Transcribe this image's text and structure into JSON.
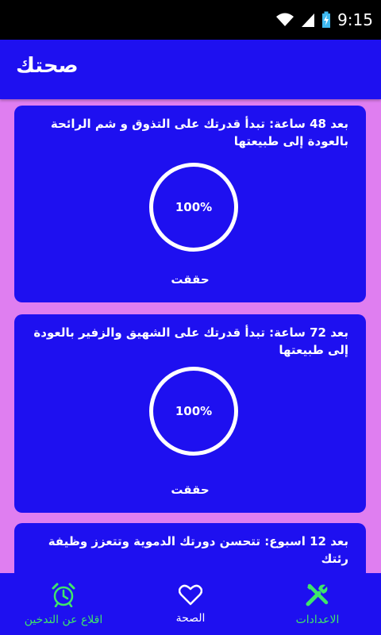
{
  "status_bar": {
    "time": "9:15"
  },
  "app_bar": {
    "title": "صحتك"
  },
  "cards": [
    {
      "text": "بعد 48 ساعة: تبدأ قدرتك على التذوق و شم الرائحة بالعودة إلى طبيعتها",
      "progress": "100%",
      "status": "حققت"
    },
    {
      "text": "بعد 72 ساعة: تبدأ قدرتك على الشهيق والزفير بالعودة إلى طبيعتها",
      "progress": "100%",
      "status": "حققت"
    },
    {
      "text": "بعد 12 اسبوع: تتحسن دورتك الدموية وتتعزز وظيفة رئتك"
    }
  ],
  "bottom_nav": {
    "quit": "اقلاع عن التدخين",
    "health": "الصحة",
    "settings": "الاعدادات"
  },
  "colors": {
    "primary": "#1e10f0",
    "background": "#df7ef0",
    "accent_green": "#3fe56a"
  }
}
